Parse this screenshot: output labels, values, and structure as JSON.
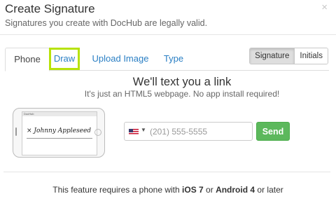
{
  "modal": {
    "title": "Create Signature",
    "close": "×",
    "subtitle": "Signatures you create with DocHub are legally valid."
  },
  "tabs": [
    {
      "label": "Phone",
      "active": true
    },
    {
      "label": "Draw",
      "highlighted": true
    },
    {
      "label": "Upload Image"
    },
    {
      "label": "Type"
    }
  ],
  "mode_toggle": {
    "options": [
      "Signature",
      "Initials"
    ],
    "selected": "Signature"
  },
  "phone_panel": {
    "heading": "We'll text you a link",
    "subheading": "It's just an HTML5 webpage. No app install required!",
    "illustration": {
      "app_label": "DocHub",
      "signature_text": "Johnny Appleseed",
      "mark": "×"
    },
    "phone_input": {
      "country_flag": "us-flag-icon",
      "placeholder": "(201) 555-5555"
    },
    "send_label": "Send"
  },
  "footer": {
    "before": "This feature requires a phone with ",
    "ios": "iOS 7",
    "or1": " or ",
    "android": "Android 4",
    "after": " or later"
  },
  "colors": {
    "link": "#2a7fc4",
    "highlight": "#b7e20a",
    "send": "#5cb85c"
  }
}
